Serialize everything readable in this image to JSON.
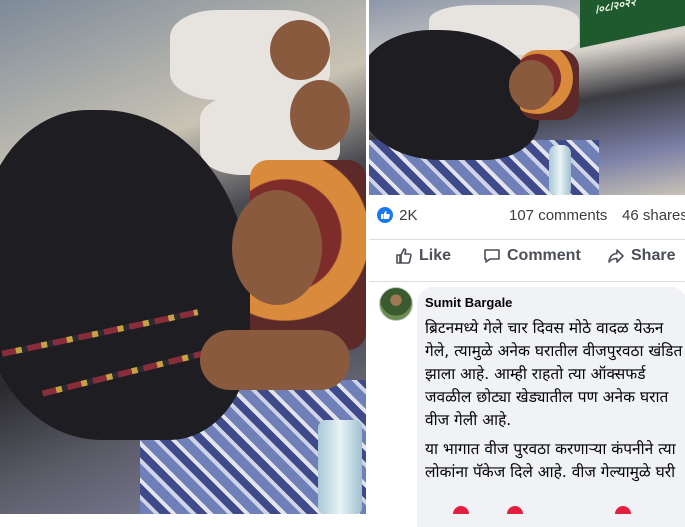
{
  "banner_text": "/०८/२०२२",
  "post": {
    "reaction_count": "2K",
    "comments_count": "107 comments",
    "shares_count": "46 shares",
    "reaction_icon": "like-thumb-icon"
  },
  "actions": {
    "like_label": "Like",
    "comment_label": "Comment",
    "share_label": "Share"
  },
  "comment": {
    "author": "Sumit Bargale",
    "paragraphs": [
      "ब्रिटनमध्ये गेले चार दिवस मोठे वादळ येऊन गेले, त्यामुळे अनेक घरातील वीजपुरवठा खंडित झाला आहे. आम्ही राहतो त्या ऑक्सफर्ड जवळील छोट्या खेड्यातील पण अनेक घरात वीज गेली आहे.",
      "या भागात वीज पुरवठा करणाऱ्या कंपनीने त्या लोकांना पॅकेज दिले आहे. वीज गेल्यामुळे घरी"
    ]
  },
  "colors": {
    "facebook_blue": "#1877f2",
    "text_primary": "#050505",
    "text_secondary": "#4b4f56",
    "bubble_bg": "#f0f2f5"
  }
}
